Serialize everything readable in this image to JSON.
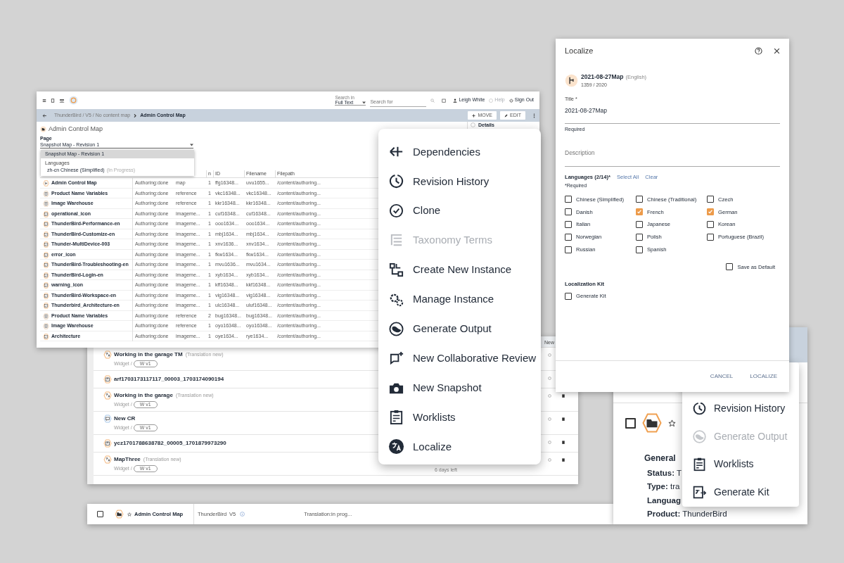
{
  "main_window": {
    "toolbar": {
      "search_in_label": "Search in",
      "search_scope": "Full Text",
      "search_placeholder": "Search for",
      "user": "Leigh White",
      "help": {
        "label": "Help",
        "disabled": true
      },
      "sign_out": "Sign Out"
    },
    "breadcrumb": {
      "path": "ThunderBird / V5 / No content map",
      "current": "Admin Control Map"
    },
    "actions": [
      {
        "label": "MOVE",
        "kind": "move"
      },
      {
        "label": "EDIT",
        "kind": "edit"
      }
    ],
    "page_title": "Admin Control Map",
    "page_field": {
      "label": "Page",
      "value": "Snapshot Map - Revision 1"
    },
    "dropdown": {
      "options": [
        {
          "label": "Snapshot Map - Revision 1",
          "selected": true
        }
      ],
      "group_label": "Languages",
      "language": {
        "label": "zh-cn Chinese (Simplified)",
        "note": "(In Progress)"
      }
    },
    "details_label": "Details",
    "table": {
      "columns": [
        "n",
        "ID",
        "Filename",
        "Filepath"
      ],
      "rows": [
        {
          "kind": "map",
          "name": "Admin Control Map",
          "status": "Authoring:done",
          "type": "map",
          "version": "1",
          "id": "ffg16348...",
          "filename": "uvu1655...",
          "filepath": "/content/authoring..."
        },
        {
          "kind": "reference",
          "name": "Product Name Variables",
          "status": "Authoring:done",
          "type": "reference",
          "version": "1",
          "id": "vkc16348...",
          "filename": "vkc16348...",
          "filepath": "/content/authoring..."
        },
        {
          "kind": "reference",
          "name": "Image Warehouse",
          "status": "Authoring:done",
          "type": "reference",
          "version": "1",
          "id": "kkr16348...",
          "filename": "kkr16348...",
          "filepath": "/content/authoring..."
        },
        {
          "kind": "image",
          "name": "operational_icon",
          "status": "Authoring:done",
          "type": "imageme...",
          "version": "1",
          "id": "cuf16348...",
          "filename": "cuf16348...",
          "filepath": "/content/authoring..."
        },
        {
          "kind": "image",
          "name": "ThunderBird-Performance-en",
          "status": "Authoring:done",
          "type": "imageme...",
          "version": "1",
          "id": "ooo1634...",
          "filename": "ooo1634...",
          "filepath": "/content/authoring..."
        },
        {
          "kind": "image",
          "name": "ThunderBird-Customize-en",
          "status": "Authoring:done",
          "type": "imageme...",
          "version": "1",
          "id": "mbj1634...",
          "filename": "mbj1634...",
          "filepath": "/content/authoring..."
        },
        {
          "kind": "image",
          "name": "Thunder-MultiDevice-003",
          "status": "Authoring:done",
          "type": "imageme...",
          "version": "1",
          "id": "xnv1636...",
          "filename": "xnv1634...",
          "filepath": "/content/authoring..."
        },
        {
          "kind": "image",
          "name": "error_icon",
          "status": "Authoring:done",
          "type": "imageme...",
          "version": "1",
          "id": "fkw1634...",
          "filename": "fkw1634...",
          "filepath": "/content/authoring..."
        },
        {
          "kind": "image",
          "name": "ThunderBird-Troubleshooting-en",
          "status": "Authoring:done",
          "type": "imageme...",
          "version": "1",
          "id": "mvu1636...",
          "filename": "mvu1634...",
          "filepath": "/content/authoring..."
        },
        {
          "kind": "image",
          "name": "ThunderBird-Login-en",
          "status": "Authoring:done",
          "type": "imageme...",
          "version": "1",
          "id": "xyb1634...",
          "filename": "xyb1634...",
          "filepath": "/content/authoring..."
        },
        {
          "kind": "image",
          "name": "warning_icon",
          "status": "Authoring:done",
          "type": "imageme...",
          "version": "1",
          "id": "kff16348...",
          "filename": "kkf16348...",
          "filepath": "/content/authoring..."
        },
        {
          "kind": "image",
          "name": "ThunderBird-Workspace-en",
          "status": "Authoring:done",
          "type": "imageme...",
          "version": "1",
          "id": "vig16348...",
          "filename": "vig16348...",
          "filepath": "/content/authoring..."
        },
        {
          "kind": "image",
          "name": "Thunderbird_Architecture-en",
          "status": "Authoring:done",
          "type": "imageme...",
          "version": "1",
          "id": "ulc16348...",
          "filename": "uluf16348...",
          "filepath": "/content/authoring..."
        },
        {
          "kind": "reference",
          "name": "Product Name Variables",
          "status": "Authoring:done",
          "type": "reference",
          "version": "2",
          "id": "bug16348...",
          "filename": "bug16348...",
          "filepath": "/content/authoring..."
        },
        {
          "kind": "reference",
          "name": "Image Warehouse",
          "status": "Authoring:done",
          "type": "reference",
          "version": "1",
          "id": "oyo16348...",
          "filename": "oyo16348...",
          "filepath": "/content/authoring..."
        },
        {
          "kind": "image",
          "name": "Architecture",
          "status": "Authoring:done",
          "type": "imageme...",
          "version": "1",
          "id": "oye1634...",
          "filename": "rye1634...",
          "filepath": "/content/authoring..."
        }
      ]
    }
  },
  "list_panel": {
    "column_header": "New",
    "items": [
      {
        "kind": "translation",
        "title": "Working in the garage TM",
        "note": "(Translation new)",
        "widget": "Widget /",
        "chip": "W v1"
      },
      {
        "kind": "output",
        "title": "arf1703173117117_00003_1703174090194"
      },
      {
        "kind": "translation",
        "title": "Working in the garage",
        "note": "(Translation new)",
        "widget": "Widget /",
        "chip": "W v1"
      },
      {
        "kind": "review",
        "title": "New CR",
        "widget": "Widget /",
        "chip": "W v1"
      },
      {
        "kind": "output",
        "title": "ycz1701788638782_00005_1701879973290"
      },
      {
        "kind": "translation",
        "title": "MapThree",
        "note": "(Translation new)",
        "widget": "Widget /",
        "chip": "W v1",
        "due": "6 days left"
      }
    ]
  },
  "bottom_row": {
    "checked": false,
    "title": "Admin Control Map",
    "product": "ThunderBird",
    "version": "V5",
    "status": "Translation:in prog..."
  },
  "details_panel": {
    "checked": false,
    "section": "General",
    "lines": [
      "**Status:** T",
      "**Type:** tra",
      "**Languag**",
      "**Product:** ThunderBird"
    ]
  },
  "context_menu": {
    "items": [
      {
        "kind": "dependencies",
        "label": "Dependencies",
        "disabled": false
      },
      {
        "kind": "history",
        "label": "Revision History",
        "disabled": false
      },
      {
        "kind": "clone",
        "label": "Clone",
        "disabled": false
      },
      {
        "kind": "taxonomy",
        "label": "Taxonomy Terms",
        "disabled": true
      },
      {
        "kind": "instance",
        "label": "Create New Instance",
        "disabled": false
      },
      {
        "kind": "manage",
        "label": "Manage Instance",
        "disabled": false
      },
      {
        "kind": "output",
        "label": "Generate Output",
        "disabled": false
      },
      {
        "kind": "review",
        "label": "New Collaborative Review",
        "disabled": false
      },
      {
        "kind": "snapshot",
        "label": "New Snapshot",
        "disabled": false
      },
      {
        "kind": "worklists",
        "label": "Worklists",
        "disabled": false
      },
      {
        "kind": "localize",
        "label": "Localize",
        "disabled": false
      }
    ]
  },
  "small_menu": {
    "items": [
      {
        "kind": "history",
        "label": "Revision History",
        "disabled": false
      },
      {
        "kind": "output",
        "label": "Generate Output",
        "disabled": true
      },
      {
        "kind": "worklists",
        "label": "Worklists",
        "disabled": false
      },
      {
        "kind": "kit",
        "label": "Generate Kit",
        "disabled": false
      }
    ]
  },
  "localize_dialog": {
    "title": "Localize",
    "item": {
      "name": "2021-08-27Map",
      "language": "(English)",
      "counts": "1359 / 2020"
    },
    "title_field": {
      "label": "Title *",
      "value": "2021-08-27Map",
      "helper": "Required"
    },
    "description_field": {
      "placeholder": "Description"
    },
    "languages": {
      "label": "Languages (2/14)*",
      "select_all": "Select All",
      "clear": "Clear",
      "helper": "*Required",
      "options": [
        {
          "label": "Chinese (Simplified)",
          "checked": false
        },
        {
          "label": "Chinese (Traditional)",
          "checked": false
        },
        {
          "label": "Czech",
          "checked": false
        },
        {
          "label": "Danish",
          "checked": false
        },
        {
          "label": "French",
          "checked": true
        },
        {
          "label": "German",
          "checked": true
        },
        {
          "label": "Italian",
          "checked": false
        },
        {
          "label": "Japanese",
          "checked": false
        },
        {
          "label": "Korean",
          "checked": false
        },
        {
          "label": "Norwegian",
          "checked": false
        },
        {
          "label": "Polish",
          "checked": false
        },
        {
          "label": "Portuguese (Brazil)",
          "checked": false
        },
        {
          "label": "Russian",
          "checked": false
        },
        {
          "label": "Spanish",
          "checked": false
        }
      ]
    },
    "save_default": {
      "label": "Save as Default",
      "checked": false
    },
    "kit_heading": "Localization Kit",
    "generate_kit": {
      "label": "Generate Kit",
      "checked": false
    },
    "buttons": [
      "CANCEL",
      "LOCALIZE"
    ]
  }
}
